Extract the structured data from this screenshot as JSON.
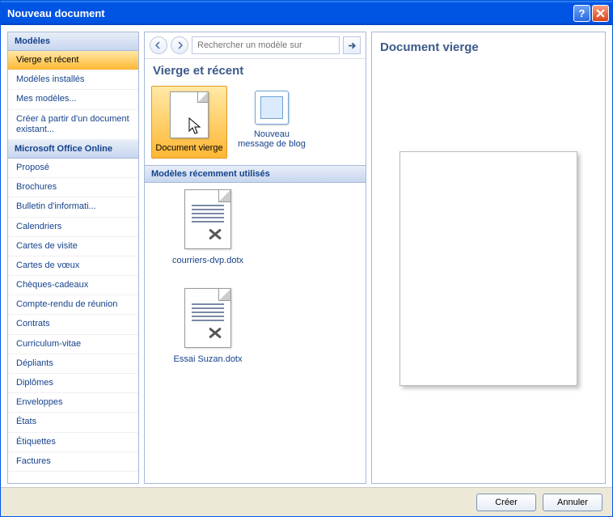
{
  "window": {
    "title": "Nouveau document"
  },
  "sidebar": {
    "header1": "Modèles",
    "header2": "Microsoft Office Online",
    "group1": [
      "Vierge et récent",
      "Modèles installés",
      "Mes modèles...",
      "Créer à partir d'un document existant..."
    ],
    "group2": [
      "Proposé",
      "Brochures",
      "Bulletin d'informati...",
      "Calendriers",
      "Cartes de visite",
      "Cartes de vœux",
      "Chèques-cadeaux",
      "Compte-rendu de réunion",
      "Contrats",
      "Curriculum-vitae",
      "Dépliants",
      "Diplômes",
      "Enveloppes",
      "États",
      "Étiquettes",
      "Factures"
    ],
    "selected": "Vierge et récent"
  },
  "toolbar": {
    "search_placeholder": "Rechercher un modèle sur"
  },
  "middle": {
    "section_title": "Vierge et récent",
    "templates": [
      {
        "label": "Document vierge",
        "kind": "doc",
        "selected": true
      },
      {
        "label": "Nouveau message de blog",
        "kind": "blog",
        "selected": false
      }
    ],
    "recent_header": "Modèles récemment utilisés",
    "recent": [
      {
        "label": "courriers-dvp.dotx"
      },
      {
        "label": "Essai Suzan.dotx"
      }
    ]
  },
  "preview": {
    "title": "Document vierge"
  },
  "footer": {
    "create": "Créer",
    "cancel": "Annuler"
  }
}
